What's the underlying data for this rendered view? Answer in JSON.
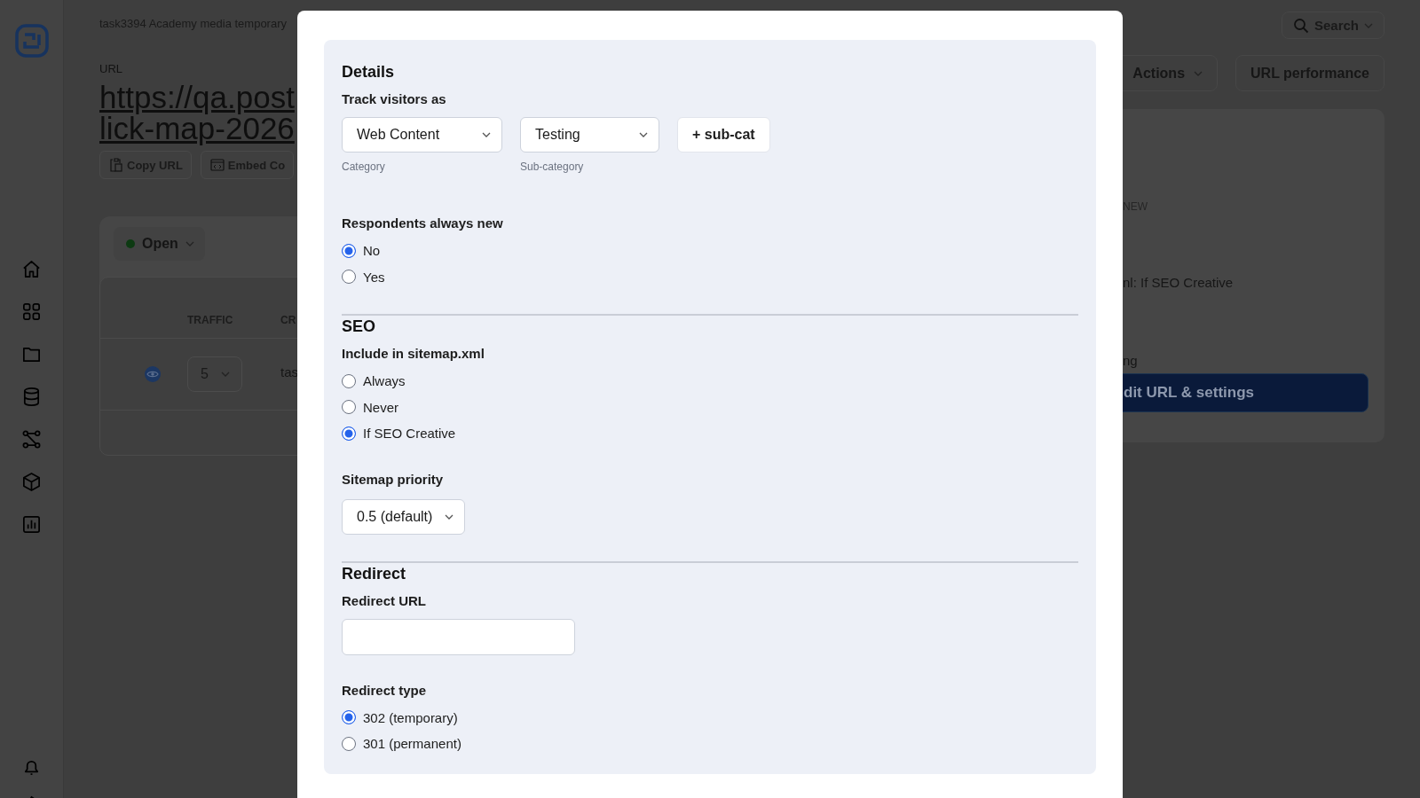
{
  "breadcrumb": "task3394 Academy media temporary",
  "url_label": "URL",
  "url_lines": [
    "https://qa.post",
    "lick-map-2026"
  ],
  "url_buttons": [
    "Copy URL",
    "Embed Co"
  ],
  "status_dropdown": "Open",
  "table": {
    "columns": [
      "TRAFFIC",
      "CR"
    ],
    "rows": [
      {
        "traffic": "5",
        "column_2": "tas"
      }
    ]
  },
  "search": "Search",
  "header_buttons": [
    {
      "label": "Actions",
      "kind": "dropdown"
    },
    {
      "label": "URL performance",
      "kind": "plain"
    }
  ],
  "summary_card": {
    "lines": [
      {
        "text": "NEW",
        "kind": "caption"
      },
      {
        "text": "nl: If SEO Creative",
        "kind": "value"
      },
      {
        "text": "ng",
        "kind": "value"
      }
    ],
    "button": "dit URL & settings"
  },
  "modal": {
    "sections": [
      {
        "title": "Details",
        "fields": [
          {
            "kind": "selects",
            "label": "Track visitors as",
            "selects": [
              {
                "value": "Web Content",
                "caption": "Category"
              },
              {
                "value": "Testing",
                "caption": "Sub-category"
              }
            ],
            "button": "+ sub-cat"
          },
          {
            "kind": "radio",
            "label": "Respondents always new",
            "options": [
              {
                "label": "No",
                "selected": true
              },
              {
                "label": "Yes",
                "selected": false
              }
            ]
          }
        ]
      },
      {
        "title": "SEO",
        "fields": [
          {
            "kind": "radio",
            "label": "Include in sitemap.xml",
            "options": [
              {
                "label": "Always",
                "selected": false
              },
              {
                "label": "Never",
                "selected": false
              },
              {
                "label": "If SEO Creative",
                "selected": true
              }
            ]
          },
          {
            "kind": "select",
            "label": "Sitemap priority",
            "value": "0.5 (default)"
          }
        ]
      },
      {
        "title": "Redirect",
        "fields": [
          {
            "kind": "text",
            "label": "Redirect URL"
          },
          {
            "kind": "radio",
            "label": "Redirect type",
            "options": [
              {
                "label": "302 (temporary)",
                "selected": true
              },
              {
                "label": "301 (permanent)",
                "selected": false
              }
            ]
          }
        ]
      }
    ]
  }
}
